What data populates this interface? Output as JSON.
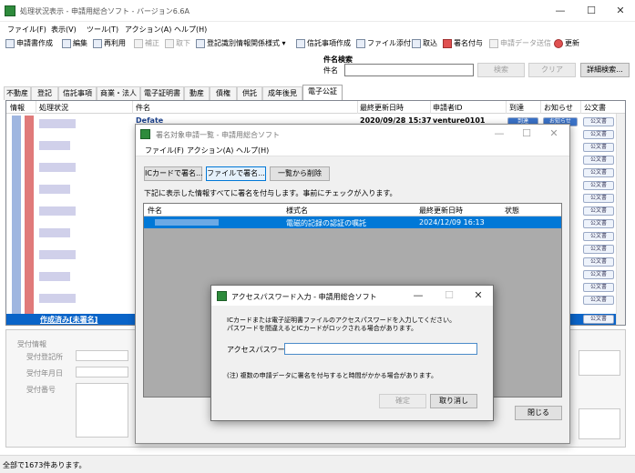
{
  "window": {
    "title": "処理状況表示 - 申請用総合ソフト - バージョン6.6A",
    "min": "—",
    "max": "☐",
    "close": "✕"
  },
  "menu": [
    "ファイル(F)",
    "表示(V)",
    "ツール(T)",
    "アクション(A)",
    "ヘルプ(H)"
  ],
  "toolbar": [
    {
      "label": "申請書作成",
      "disabled": false
    },
    {
      "label": "編集",
      "disabled": false
    },
    {
      "label": "再利用",
      "disabled": false
    },
    {
      "label": "補正",
      "disabled": true
    },
    {
      "label": "取下",
      "disabled": true
    },
    {
      "label": "登記識別情報関係様式 ▾",
      "disabled": false
    },
    {
      "label": "信託事項作成",
      "disabled": false
    },
    {
      "label": "ファイル添付",
      "disabled": false
    },
    {
      "label": "取込",
      "disabled": false
    },
    {
      "label": "署名付与",
      "disabled": false
    },
    {
      "label": "申請データ送信",
      "disabled": true
    },
    {
      "label": "更新",
      "disabled": false
    }
  ],
  "search": {
    "group_label": "件名検索",
    "field_label": "件名",
    "value": "",
    "search_btn": "検索",
    "clear_btn": "クリア",
    "detail_btn": "詳細検索..."
  },
  "tabs": [
    "不動産",
    "登記",
    "信託事項",
    "商業・法人",
    "電子証明書",
    "動産",
    "債権",
    "供託",
    "成年後見",
    "電子公証"
  ],
  "grid": {
    "columns": [
      "情報",
      "処理状況",
      "件名",
      "最終更新日時",
      "申請者ID",
      "到達",
      "お知らせ",
      "公文書"
    ],
    "first_row": {
      "subject": "Defate",
      "updated": "2020/09/28 15:37",
      "applicant": "venture0101",
      "arrival": "到達",
      "notice": "お知らせ"
    },
    "row_button": "公文書",
    "selected_status": "作成済み[未署名]"
  },
  "lower": {
    "section": "受付情報",
    "fields": [
      "受付登記所",
      "受付年月日",
      "受付番号"
    ]
  },
  "statusbar": "全部で1673件あります。",
  "sign_dialog": {
    "title": "署名対象申請一覧 - 申請用総合ソフト",
    "menu": [
      "ファイル(F)",
      "アクション(A)",
      "ヘルプ(H)"
    ],
    "btn_ic": "ICカードで署名...",
    "btn_file": "ファイルで署名...",
    "btn_remove": "一覧から削除",
    "instruction": "下記に表示した情報すべてに署名を付与します。事前にチェックが入ります。",
    "columns": [
      "件名",
      "様式名",
      "最終更新日時",
      "状態"
    ],
    "row": {
      "form": "電磁的記録の認証の嘱託",
      "updated": "2024/12/09 16:13"
    },
    "close_btn": "閉じる"
  },
  "pw_dialog": {
    "title": "アクセスパスワード入力 - 申請用総合ソフト",
    "msg1": "ICカードまたは電子証明書ファイルのアクセスパスワードを入力してください。",
    "msg2": "パスワードを間違えるとICカードがロックされる場合があります。",
    "label": "アクセスパスワード",
    "value": "",
    "note": "(注) 複数の申請データに署名を付与すると時間がかかる場合があります。",
    "ok": "確定",
    "cancel": "取り消し"
  },
  "colors": {
    "accent": "#0078d7",
    "selected_row": "#0a64c8",
    "strip_red": "#e07a7a",
    "strip_blue": "#9fb6e0"
  }
}
